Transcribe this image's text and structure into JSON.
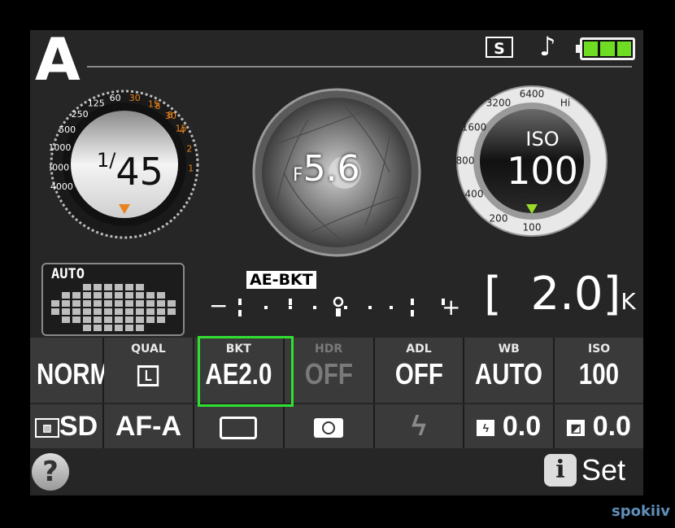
{
  "mode": "A",
  "status": {
    "release": "S",
    "beep_icon": "music-note-icon",
    "battery_level": 1.0
  },
  "shutter": {
    "fraction": "1/",
    "value": "45",
    "scale_white": [
      "4000",
      "2000",
      "1000",
      "500",
      "250",
      "125",
      "60",
      "30",
      "15",
      "8",
      "4",
      "2",
      "1"
    ],
    "scale_orange": [
      "8",
      "30",
      "15",
      "8",
      "4",
      "2",
      "1"
    ]
  },
  "aperture": {
    "prefix": "F",
    "value": "5.6"
  },
  "iso": {
    "label": "ISO",
    "value": "100",
    "scale": [
      "Hi",
      "6400",
      "3200",
      "1600",
      "800",
      "400",
      "200",
      "100"
    ]
  },
  "metering": {
    "auto_label": "AUTO"
  },
  "bracket": {
    "badge": "AE-BKT",
    "minus": "−",
    "plus": "+",
    "value": "2.0",
    "open": "[",
    "close": "]",
    "unit": "K"
  },
  "grid": {
    "row1": [
      {
        "label": "",
        "value": "NORM",
        "dim": false
      },
      {
        "label": "QUAL",
        "value": "L",
        "dim": false,
        "boxed": true
      },
      {
        "label": "BKT",
        "value": "AE2.0",
        "dim": false
      },
      {
        "label": "HDR",
        "value": "OFF",
        "dim": true
      },
      {
        "label": "ADL",
        "value": "OFF",
        "dim": false
      },
      {
        "label": "WB",
        "value": "AUTO",
        "dim": false
      },
      {
        "label": "ISO",
        "value": "100",
        "dim": false
      }
    ],
    "row2": [
      {
        "value": "SD",
        "icon": "picture-control-icon"
      },
      {
        "value": "AF-A"
      },
      {
        "value": "",
        "icon": "af-area-icon"
      },
      {
        "value": "",
        "icon": "metering-icon"
      },
      {
        "value": "",
        "icon": "flash-icon"
      },
      {
        "value": "0.0",
        "icon": "flash-compensation-icon"
      },
      {
        "value": "0.0",
        "icon": "exposure-compensation-icon"
      }
    ]
  },
  "footer": {
    "help": "?",
    "info": "i",
    "set": "Set"
  },
  "watermark": "spokiiv"
}
